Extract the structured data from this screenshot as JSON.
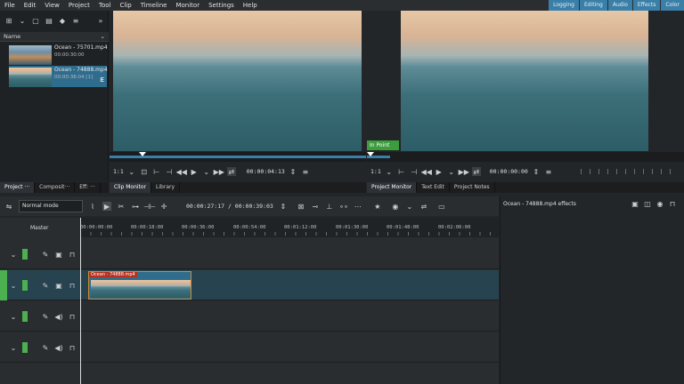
{
  "menu": [
    "File",
    "Edit",
    "View",
    "Project",
    "Tool",
    "Clip",
    "Timeline",
    "Monitor",
    "Settings",
    "Help"
  ],
  "layouts": [
    "Logging",
    "Editing",
    "Audio",
    "Effects",
    "Color"
  ],
  "bin": {
    "column_header": "Name",
    "clips": [
      {
        "name": "Ocean - 75701.mp4",
        "duration": "00:00:30:00"
      },
      {
        "name": "Ocean - 74888.mp4",
        "duration": "00:00:36:04 [1]"
      }
    ]
  },
  "clip_monitor": {
    "zoom": "1:1",
    "timecode": "00:00:04:13"
  },
  "project_monitor": {
    "zoom": "1:1",
    "timecode": "00:00:00:00",
    "in_point_label": "In Point"
  },
  "left_dock_tabs": [
    "Project ···",
    "Composit···",
    "Eff: ···",
    "Clip Monitor",
    "Library"
  ],
  "right_dock_tabs": [
    "Project Monitor",
    "Text Edit",
    "Project Notes"
  ],
  "timeline": {
    "mode": "Normal mode",
    "position": "00:00:27:17 / 00:00:39:03",
    "master_label": "Master",
    "ruler": [
      "00:00:00:00",
      "00:00:18:00",
      "00:00:36:00",
      "00:00:54:00",
      "00:01:12:00",
      "00:01:30:00",
      "00:01:48:00",
      "00:02:06:00"
    ],
    "clip_title": "Ocean - 74888.mp4"
  },
  "effects": {
    "title": "Ocean - 74888.mp4 effects"
  },
  "colors": {
    "accent": "#3a7fa8",
    "track_tag": "#4caf50",
    "clip_title": "#b5301f"
  }
}
